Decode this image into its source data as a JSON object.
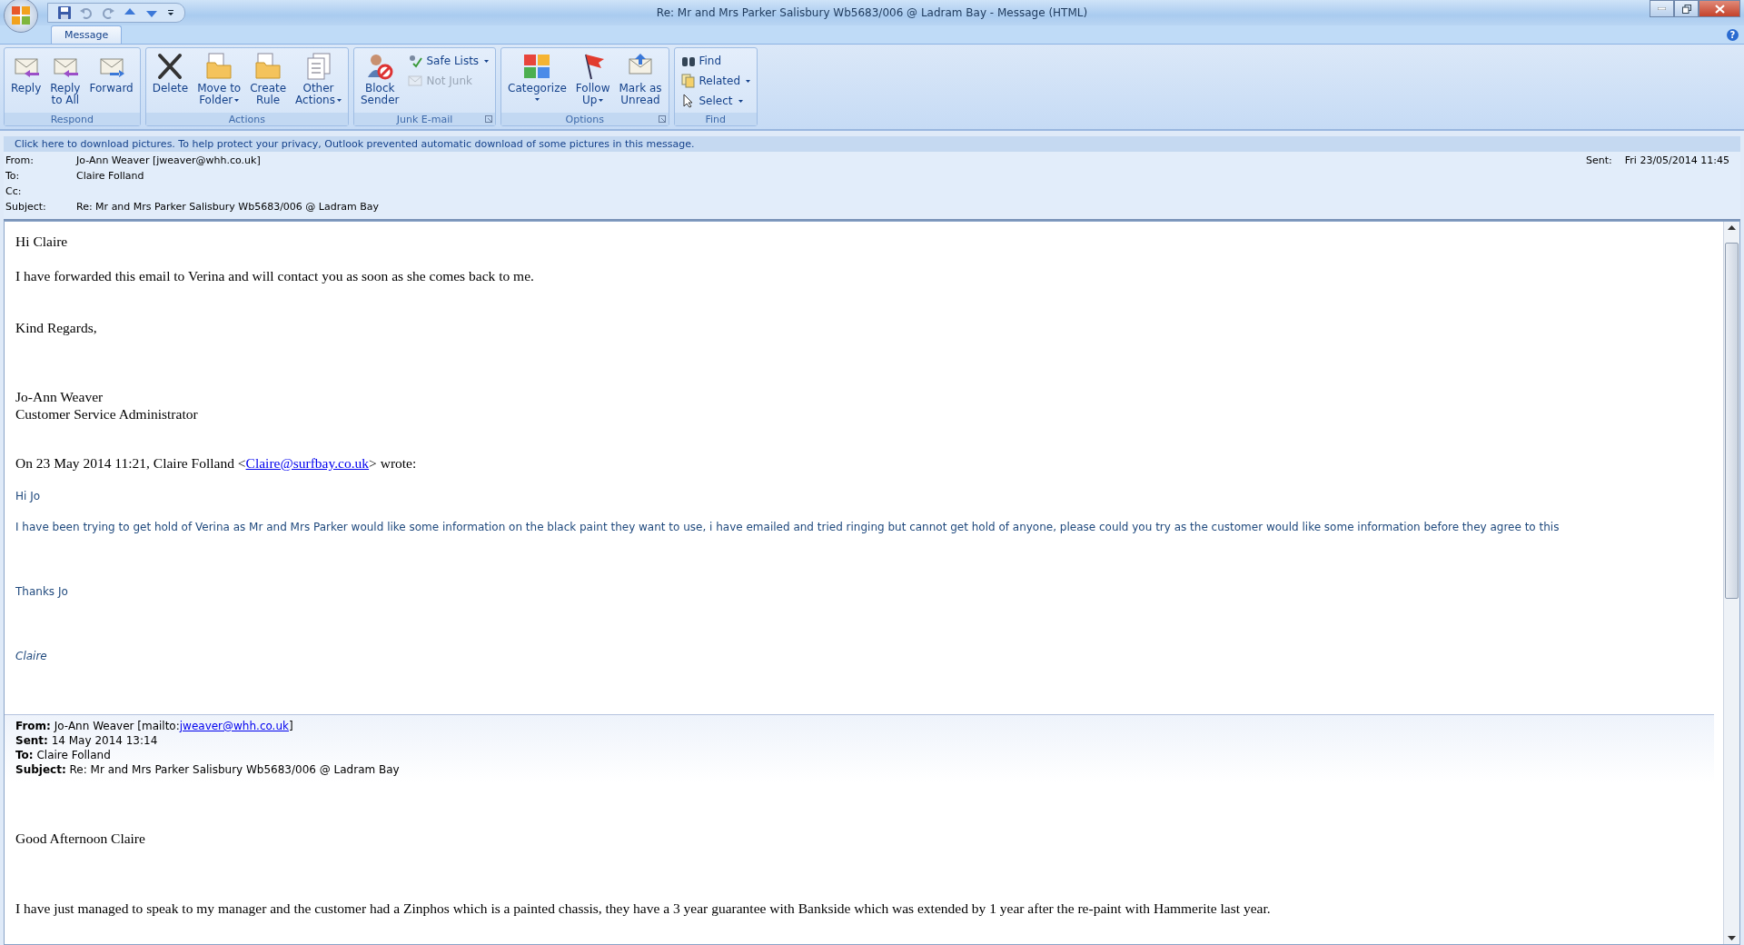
{
  "window": {
    "title": "Re: Mr and Mrs Parker Salisbury Wb5683/006 @ Ladram Bay - Message (HTML)",
    "help": "?"
  },
  "tabs": [
    {
      "label": "Message",
      "selected": true
    }
  ],
  "ribbon": {
    "groups": [
      {
        "label": "Respond",
        "launcher": false,
        "items": [
          {
            "kind": "large",
            "lines": [
              "Reply"
            ],
            "dropdown": false
          },
          {
            "kind": "large",
            "lines": [
              "Reply",
              "to All"
            ],
            "dropdown": false
          },
          {
            "kind": "large",
            "lines": [
              "Forward"
            ],
            "dropdown": false
          }
        ]
      },
      {
        "label": "Actions",
        "launcher": false,
        "items": [
          {
            "kind": "large",
            "lines": [
              "Delete"
            ],
            "dropdown": false
          },
          {
            "kind": "large",
            "lines": [
              "Move to",
              "Folder"
            ],
            "dropdown": true
          },
          {
            "kind": "large",
            "lines": [
              "Create",
              "Rule"
            ],
            "dropdown": false
          },
          {
            "kind": "large",
            "lines": [
              "Other",
              "Actions"
            ],
            "dropdown": true
          }
        ]
      },
      {
        "label": "Junk E-mail",
        "launcher": true,
        "items": [
          {
            "kind": "large",
            "lines": [
              "Block",
              "Sender"
            ],
            "dropdown": false
          },
          {
            "kind": "stack",
            "buttons": [
              {
                "label": "Safe Lists",
                "dropdown": true,
                "disabled": false
              },
              {
                "label": "Not Junk",
                "dropdown": false,
                "disabled": true
              }
            ]
          }
        ]
      },
      {
        "label": "Options",
        "launcher": true,
        "items": [
          {
            "kind": "large",
            "lines": [
              "Categorize"
            ],
            "dropdown": true
          },
          {
            "kind": "large",
            "lines": [
              "Follow",
              "Up"
            ],
            "dropdown": true
          },
          {
            "kind": "large",
            "lines": [
              "Mark as",
              "Unread"
            ],
            "dropdown": false
          }
        ]
      },
      {
        "label": "Find",
        "launcher": false,
        "items": [
          {
            "kind": "stack",
            "buttons": [
              {
                "label": "Find",
                "dropdown": false,
                "disabled": false
              },
              {
                "label": "Related",
                "dropdown": true,
                "disabled": false
              },
              {
                "label": "Select",
                "dropdown": true,
                "disabled": false
              }
            ]
          }
        ]
      }
    ]
  },
  "info_bar": "Click here to download pictures. To help protect your privacy, Outlook prevented automatic download of some pictures in this message.",
  "header": {
    "fields": [
      {
        "label": "From:",
        "value": "Jo-Ann Weaver [jweaver@whh.co.uk]"
      },
      {
        "label": "To:",
        "value": "Claire Folland"
      },
      {
        "label": "Cc:"
      },
      {
        "label": "Subject:",
        "value": "Re: Mr and Mrs Parker Salisbury Wb5683/006 @ Ladram Bay"
      }
    ],
    "sent_label": "Sent:",
    "sent_value": "Fri 23/05/2014 11:45"
  },
  "body": [
    {
      "kind": "text",
      "text": "Hi Claire"
    },
    {
      "kind": "text",
      "text": "I have forwarded this email to Verina and will contact you as soon as she comes back to me."
    },
    {
      "kind": "text",
      "text": "Kind Regards,"
    },
    {
      "kind": "text",
      "text": "Jo-Ann Weaver"
    },
    {
      "kind": "text",
      "text": "Customer Service Administrator"
    },
    {
      "kind": "intro",
      "before": "On 23 May 2014 11:21, Claire Folland <",
      "link": "Claire@surfbay.co.uk",
      "after": "> wrote:"
    },
    {
      "kind": "quote",
      "text": "Hi Jo"
    },
    {
      "kind": "quote",
      "text": "I have been trying to get hold of Verina as Mr and Mrs Parker would like some information on the black paint they want to use, i have emailed and tried ringing but cannot get hold of anyone, please could you try as the customer would like some information before they agree to this"
    },
    {
      "kind": "quote",
      "text": "Thanks Jo"
    },
    {
      "kind": "quote_italic",
      "text": "Claire"
    },
    {
      "kind": "headers",
      "lines": [
        {
          "label": "From:",
          "value": "Jo-Ann Weaver [mailto:",
          "link": "jweaver@whh.co.uk",
          "after": "]"
        },
        {
          "label": "Sent:",
          "value": "14 May 2014 13:14"
        },
        {
          "label": "To:",
          "value": "Claire Folland"
        },
        {
          "label": "Subject:",
          "value": "Re: Mr and Mrs Parker Salisbury Wb5683/006 @ Ladram Bay"
        }
      ]
    },
    {
      "kind": "text",
      "text": "Good Afternoon Claire"
    },
    {
      "kind": "text",
      "text": "I have just managed to speak to my manager and the customer had a Zinphos which is a painted chassis, they have a 3 year guarantee with Bankside which was extended by 1 year after the re-paint with Hammerite last year."
    }
  ]
}
